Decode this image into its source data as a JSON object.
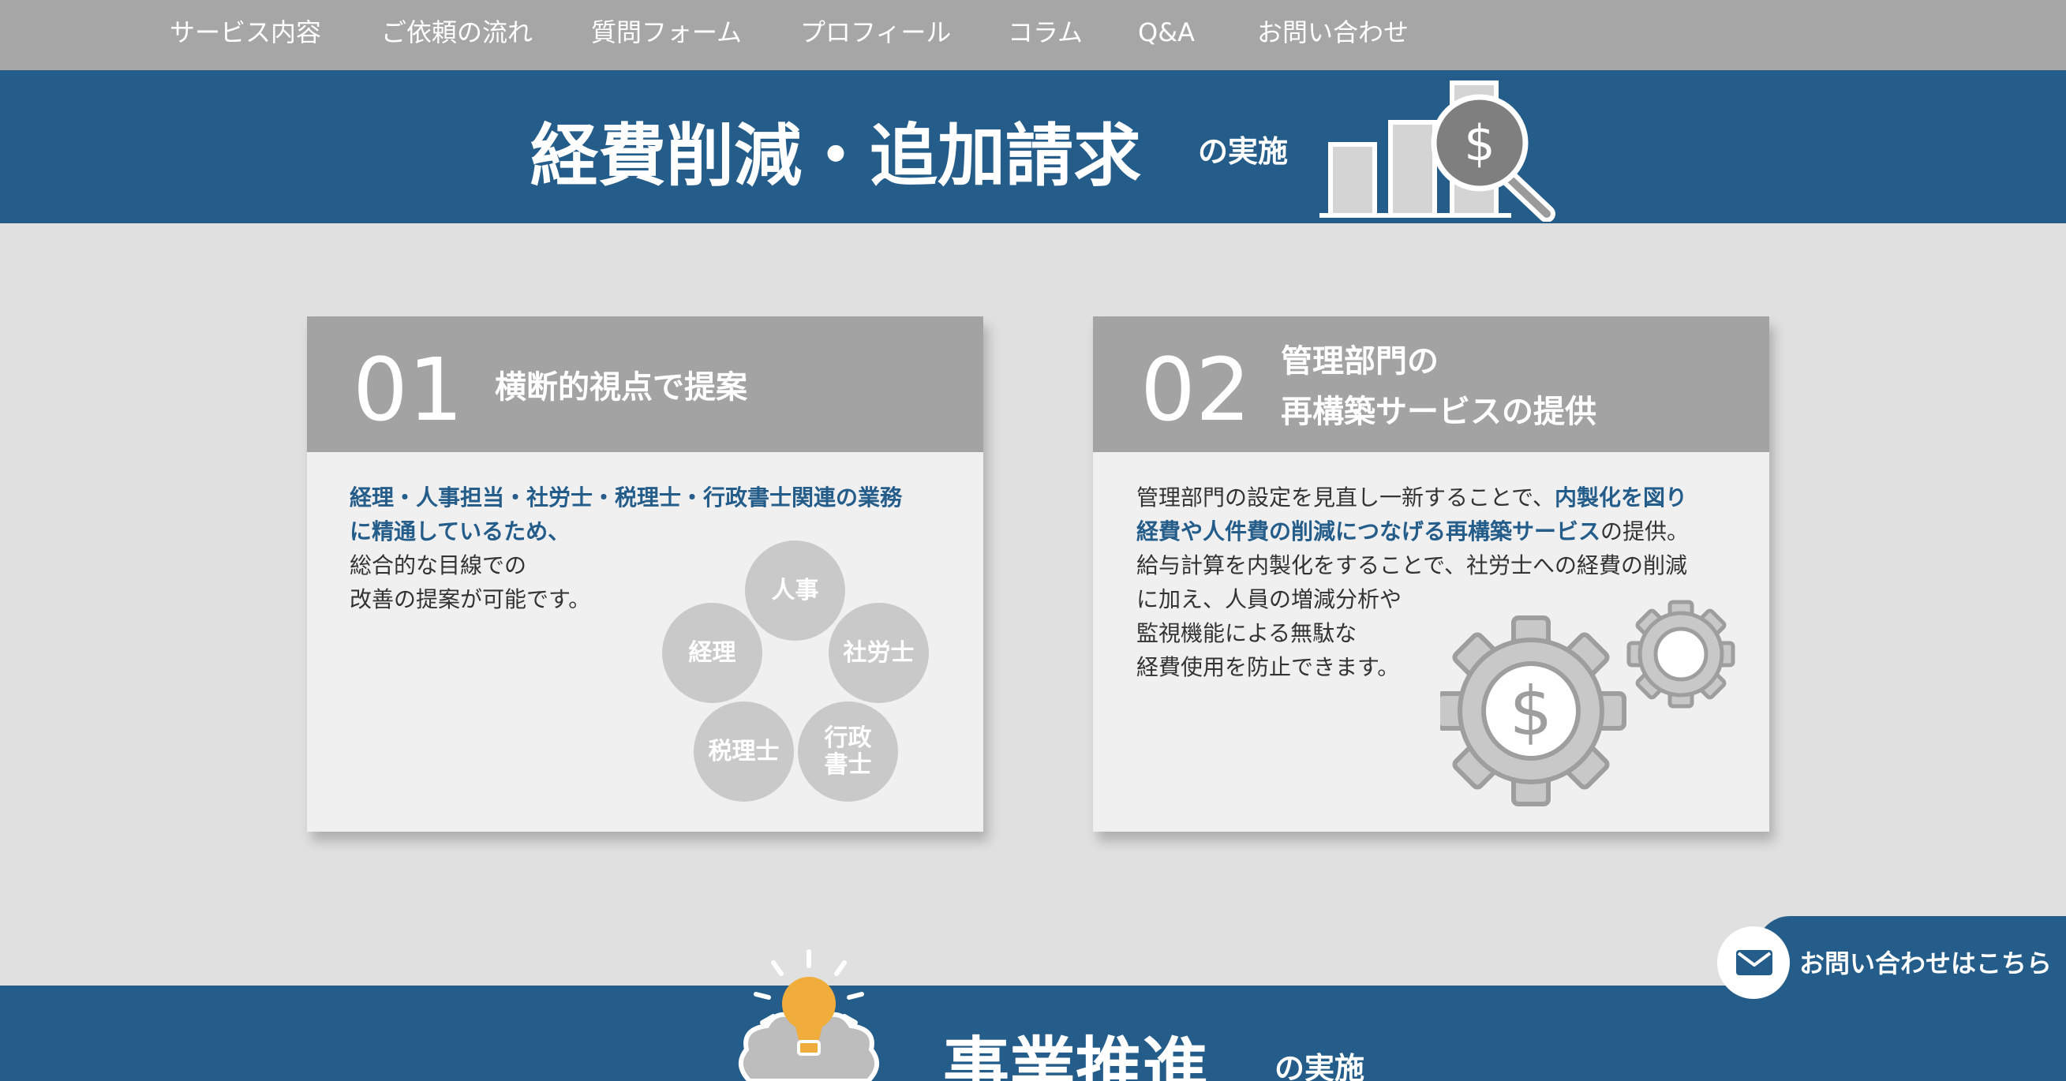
{
  "nav": {
    "items": [
      "サービス内容",
      "ご依頼の流れ",
      "質問フォーム",
      "プロフィール",
      "コラム",
      "Q&A",
      "お問い合わせ"
    ]
  },
  "section1": {
    "title": "経費削減・追加請求",
    "suffix": "の実施",
    "icon": "bar-chart-dollar-magnifier-icon"
  },
  "card1": {
    "number": "01",
    "title": "横断的視点で提案",
    "highlight_lines": [
      "経理・人事担当・社労士・税理士・行政書士関連の業務",
      "に精通しているため、"
    ],
    "text_lines": [
      "総合的な目線での",
      "改善の提案が可能です。"
    ],
    "circles": [
      "人事",
      "経理",
      "社労士",
      "税理士",
      "行政書士"
    ]
  },
  "card2": {
    "number": "02",
    "title_line1": "管理部門の",
    "title_line2": "再構築サービスの提供",
    "p1_a": "管理部門の設定を見直し一新することで、",
    "p1_b": "内製化を図り",
    "p2_a": "経費や人件費の削減につなげる再構築サービス",
    "p2_b": "の提供。",
    "lines": [
      "給与計算を内製化をすることで、社労士への経費の削減",
      "に加え、人員の増減分析や",
      "監視機能による無駄な",
      "経費使用を防止できます。"
    ],
    "icon": "gears-dollar-icon"
  },
  "section2": {
    "title": "事業推進",
    "suffix": "の実施",
    "icon": "lightbulb-brain-icon"
  },
  "contact": {
    "label": "お問い合わせはこちら",
    "icon": "mail-icon"
  },
  "colors": {
    "nav_bg": "#a6a6a6",
    "brand_blue": "#245c8a",
    "card_head": "#a3a3a3",
    "page_bg": "#e0e0e0",
    "bulb": "#f0ad3c"
  }
}
